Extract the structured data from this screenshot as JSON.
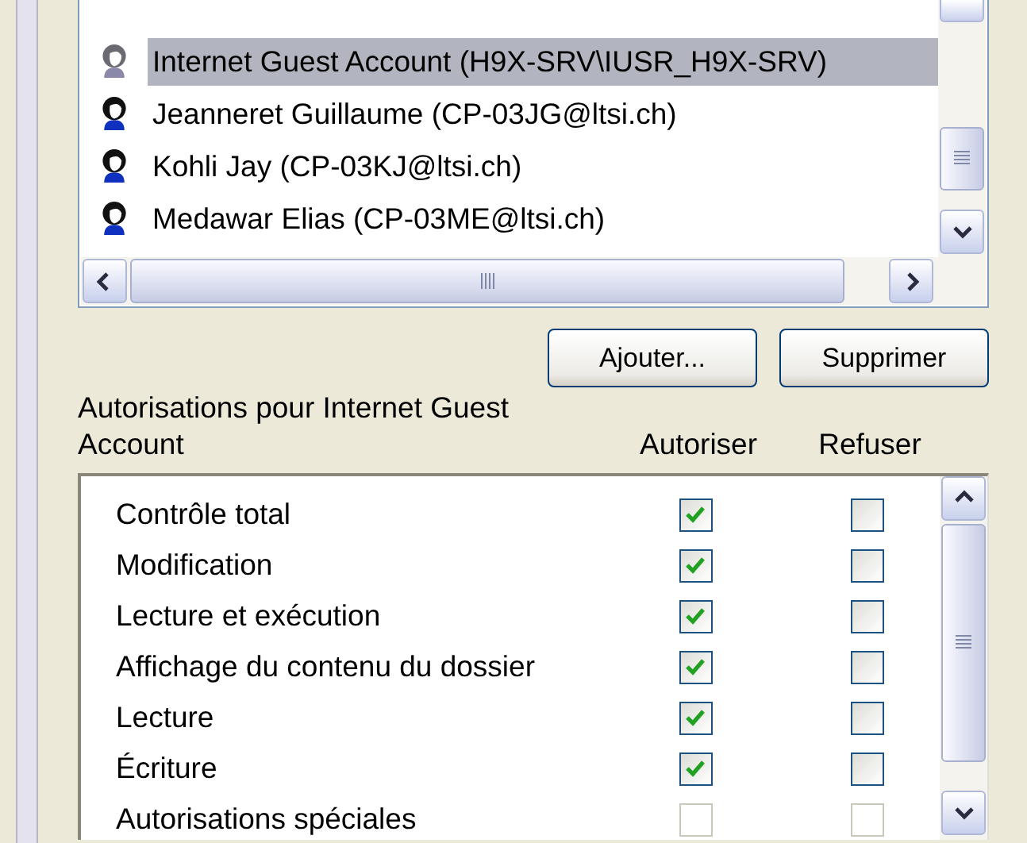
{
  "users": [
    {
      "label": "Internet Guest Account (H9X-SRV\\IUSR_H9X-SRV)",
      "selected": true,
      "disabled": true
    },
    {
      "label": "Jeanneret Guillaume (CP-03JG@ltsi.ch)",
      "selected": false,
      "disabled": false
    },
    {
      "label": "Kohli Jay (CP-03KJ@ltsi.ch)",
      "selected": false,
      "disabled": false
    },
    {
      "label": "Medawar Elias (CP-03ME@ltsi.ch)",
      "selected": false,
      "disabled": false
    }
  ],
  "buttons": [
    "Ajouter...",
    "Supprimer"
  ],
  "permissions_label": "Autorisations pour Internet Guest Account",
  "columns": [
    "Autoriser",
    "Refuser"
  ],
  "permissions": [
    {
      "name": "Contrôle total",
      "allow": true,
      "deny": false,
      "disabled": false
    },
    {
      "name": "Modification",
      "allow": true,
      "deny": false,
      "disabled": false
    },
    {
      "name": "Lecture et exécution",
      "allow": true,
      "deny": false,
      "disabled": false
    },
    {
      "name": "Affichage du contenu du dossier",
      "allow": true,
      "deny": false,
      "disabled": false
    },
    {
      "name": "Lecture",
      "allow": true,
      "deny": false,
      "disabled": false
    },
    {
      "name": "Écriture",
      "allow": true,
      "deny": false,
      "disabled": false
    },
    {
      "name": "Autorisations spéciales",
      "allow": false,
      "deny": false,
      "disabled": true
    }
  ]
}
